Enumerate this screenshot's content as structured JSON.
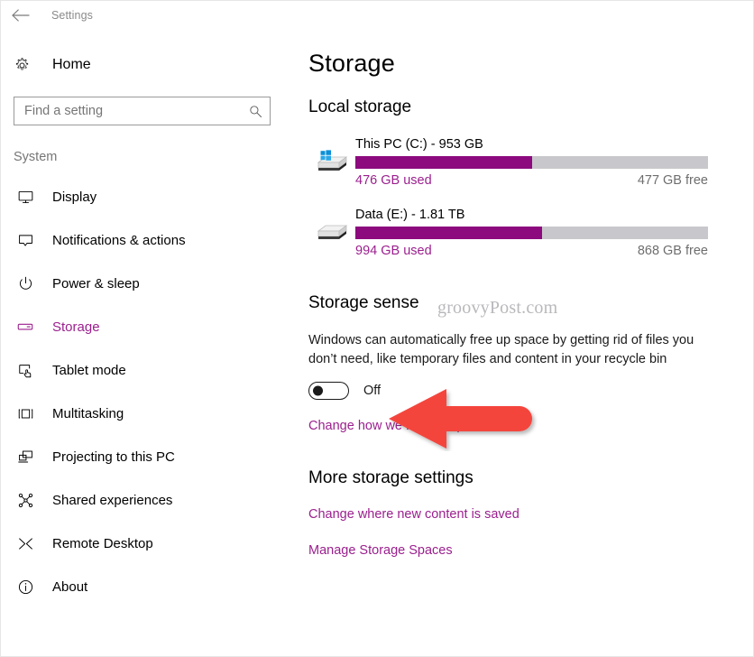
{
  "titlebar": {
    "back_icon": "back-arrow-icon",
    "title": "Settings"
  },
  "sidebar": {
    "home": {
      "label": "Home",
      "icon": "gear-icon"
    },
    "search": {
      "value": "",
      "placeholder": "Find a setting",
      "icon": "search-icon"
    },
    "group_title": "System",
    "items": [
      {
        "label": "Display",
        "icon": "monitor-icon",
        "selected": false
      },
      {
        "label": "Notifications & actions",
        "icon": "speech-bubble-icon",
        "selected": false
      },
      {
        "label": "Power & sleep",
        "icon": "power-icon",
        "selected": false
      },
      {
        "label": "Storage",
        "icon": "drive-icon",
        "selected": true
      },
      {
        "label": "Tablet mode",
        "icon": "tablet-hand-icon",
        "selected": false
      },
      {
        "label": "Multitasking",
        "icon": "multitask-icon",
        "selected": false
      },
      {
        "label": "Projecting to this PC",
        "icon": "project-screen-icon",
        "selected": false
      },
      {
        "label": "Shared experiences",
        "icon": "share-nodes-icon",
        "selected": false
      },
      {
        "label": "Remote Desktop",
        "icon": "remote-desktop-icon",
        "selected": false
      },
      {
        "label": "About",
        "icon": "info-circle-icon",
        "selected": false
      }
    ]
  },
  "main": {
    "page_title": "Storage",
    "local_storage": {
      "title": "Local storage",
      "drives": [
        {
          "name": "This PC (C:) - 953 GB",
          "used_label": "476 GB used",
          "free_label": "477 GB free",
          "used_percent": 50,
          "icon": "windows-drive-icon"
        },
        {
          "name": "Data (E:) - 1.81 TB",
          "used_label": "994 GB used",
          "free_label": "868 GB free",
          "used_percent": 53,
          "icon": "data-drive-icon"
        }
      ]
    },
    "storage_sense": {
      "title": "Storage sense",
      "description": "Windows can automatically free up space by getting rid of files you don’t need, like temporary files and content in your recycle bin",
      "toggle_state": "Off",
      "toggle_on": false,
      "link": "Change how we free up space"
    },
    "more_settings": {
      "title": "More storage settings",
      "links": [
        "Change where new content is saved",
        "Manage Storage Spaces"
      ]
    }
  },
  "annotations": {
    "watermark": "groovyPost.com",
    "arrow": {
      "name": "red-arrow-annotation",
      "color": "#f4453c",
      "direction": "left"
    }
  },
  "colors": {
    "accent": "#9b1f8e",
    "bar_used": "#8c0a7e",
    "bar_track": "#c8c8cc",
    "muted_text": "#6e6e6e",
    "arrow_red": "#f4453c"
  }
}
